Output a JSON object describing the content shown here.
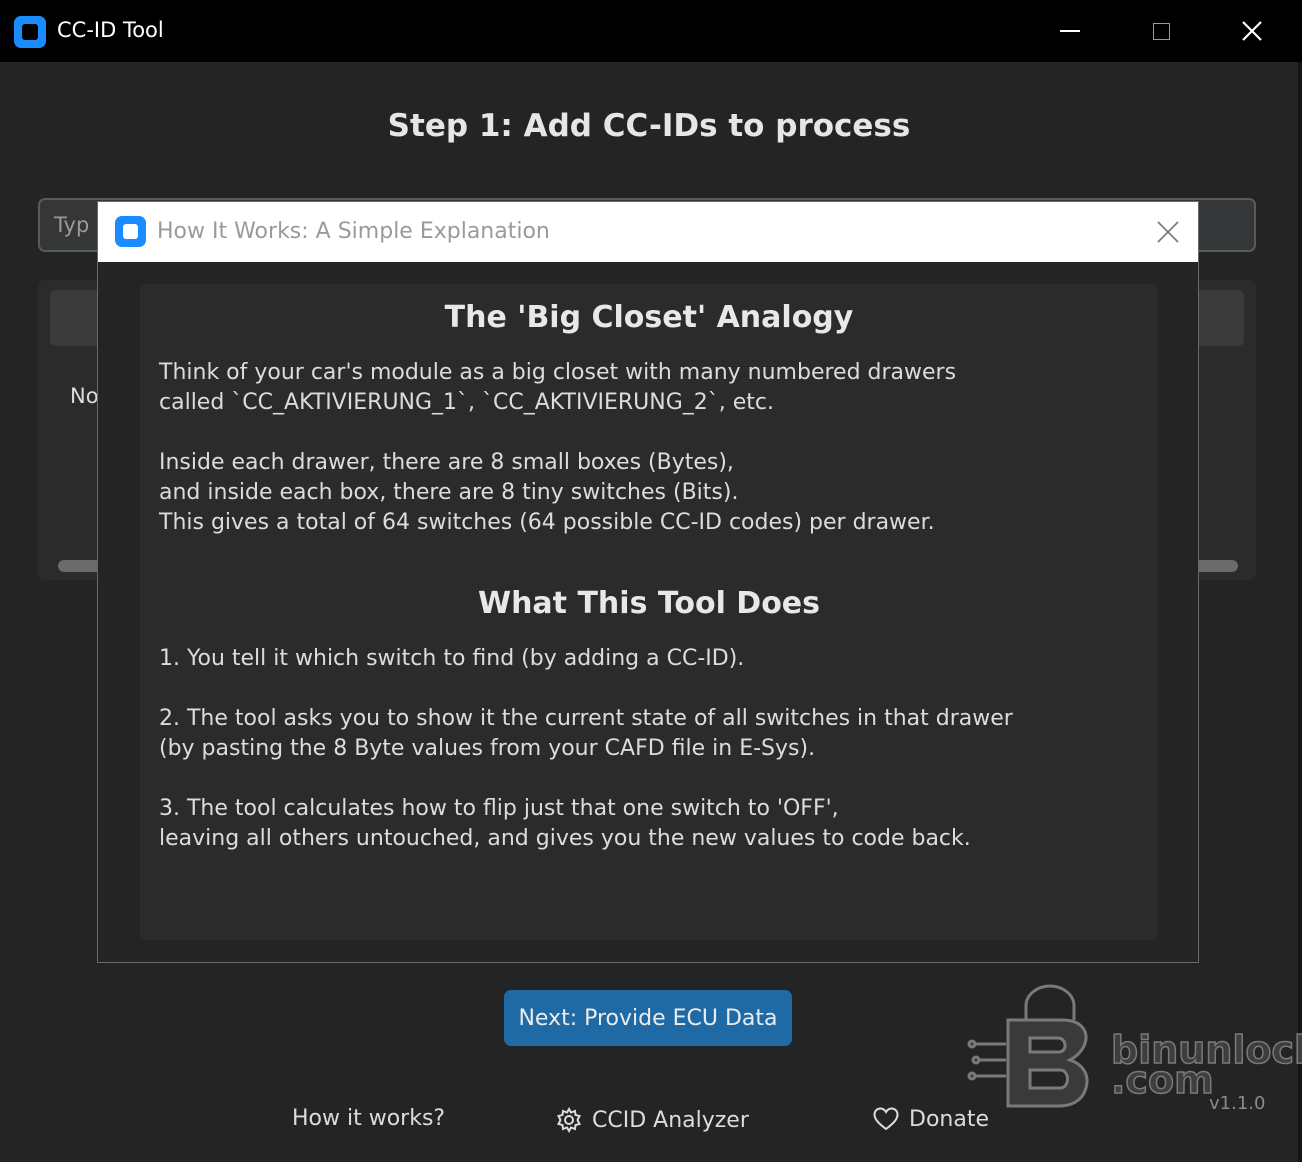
{
  "window": {
    "title": "CC-ID Tool",
    "icon": "app-logo-icon"
  },
  "main": {
    "step_title": "Step 1: Add CC-IDs to process",
    "input_placeholder_visible": "Typ",
    "list_empty_visible": "No",
    "next_button": "Next: Provide ECU Data",
    "links": {
      "how_it_works": "How it works?",
      "ccid_analyzer": "CCID Analyzer",
      "donate": "Donate"
    },
    "version": "v1.1.0",
    "watermark": {
      "line1": "binunlock",
      "line2": ".com"
    }
  },
  "modal": {
    "title": "How It Works: A Simple Explanation",
    "heading1": "The 'Big Closet' Analogy",
    "para1": "Think of your car's module as a big closet with many numbered drawers\ncalled `CC_AKTIVIERUNG_1`, `CC_AKTIVIERUNG_2`, etc.",
    "para2": "Inside each drawer, there are 8 small boxes (Bytes),\nand inside each box, there are 8 tiny switches (Bits).\nThis gives a total of 64 switches (64 possible CC-ID codes) per drawer.",
    "heading2": "What This Tool Does",
    "step1": "1. You tell it which switch to find (by adding a CC-ID).",
    "step2": "2. The tool asks you to show it the current state of all switches in that drawer\n(by pasting the 8 Byte values from your CAFD file in E-Sys).",
    "step3": "3. The tool calculates how to flip just that one switch to 'OFF',\nleaving all others untouched, and gives you the new values to code back."
  },
  "colors": {
    "accent": "#1f6aa5",
    "logo": "#1a8cff",
    "background": "#242424",
    "panel": "#2b2b2b"
  }
}
